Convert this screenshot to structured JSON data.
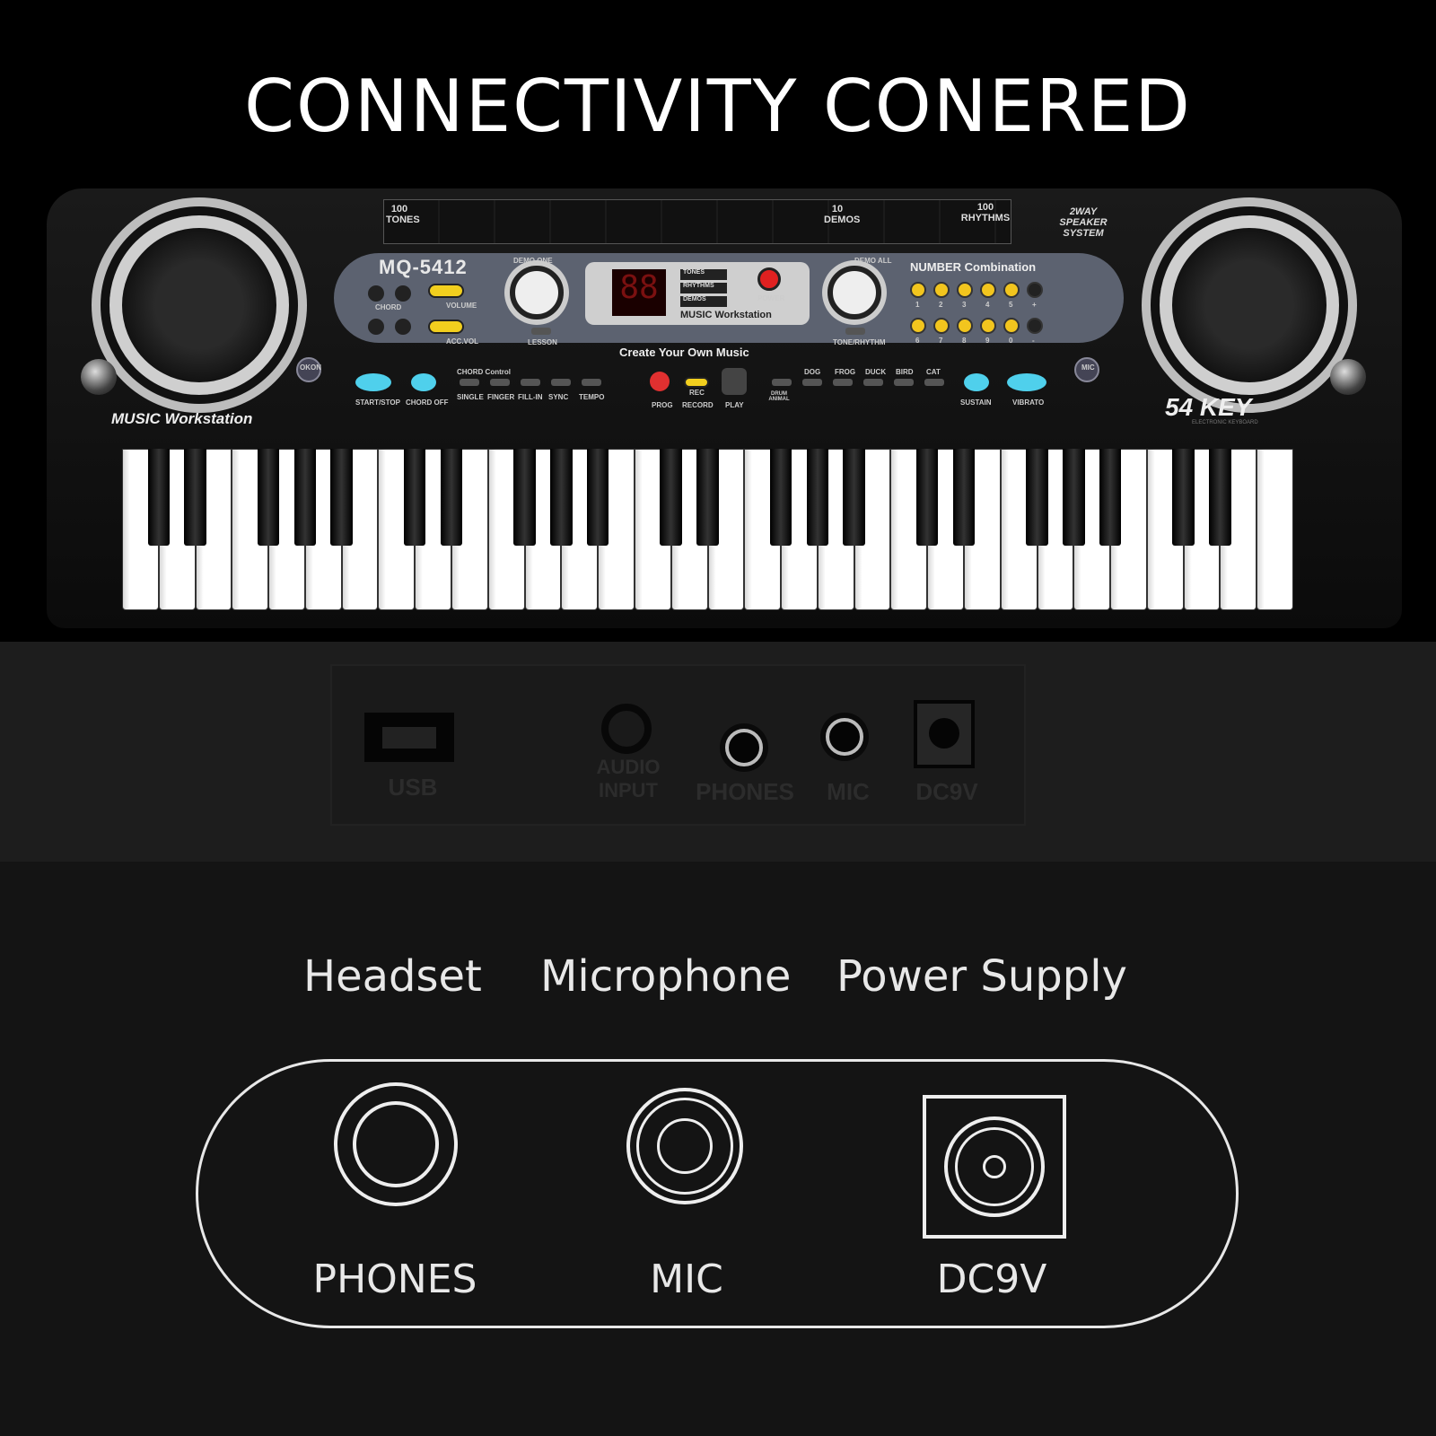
{
  "title": "CONNECTIVITY CONERED",
  "keyboard": {
    "model": "MQ-5412",
    "tones_badge": "100 TONES",
    "demos_badge": "10 DEMOS",
    "rhythms_badge": "100 RHYTHMS",
    "speaker_system": "2WAY SPEAKER SYSTEM",
    "display": "88",
    "mode_labels": [
      "TONES",
      "RHYTHMS",
      "DEMOS"
    ],
    "power_label": "POWER",
    "lcd_brand": "MUSIC Workstation",
    "demo_one": "DEMO ONE",
    "demo_all": "DEMO ALL",
    "number_combination": "NUMBER Combination",
    "numbers": [
      "1",
      "2",
      "3",
      "4",
      "5",
      "+",
      "6",
      "7",
      "8",
      "9",
      "0",
      "-"
    ],
    "chord_label": "CHORD",
    "volume_label": "VOLUME",
    "acc_vol_label": "ACC.VOL",
    "lesson_label": "LESSON",
    "tone_rhythm_label": "TONE/RHYTHM",
    "slogan": "Create Your Own Music",
    "okon_label": "OKON",
    "mic_label": "MIC",
    "start_stop": "START/STOP",
    "chord_off": "CHORD OFF",
    "chord_control": "CHORD Control",
    "chord_modes": [
      "SINGLE",
      "FINGER",
      "FILL-IN",
      "SYNC",
      "TEMPO"
    ],
    "prog": "PROG",
    "rec": "REC",
    "record": "RECORD",
    "play": "PLAY",
    "animal_sounds": [
      "DOG",
      "FROG",
      "DUCK",
      "BIRD",
      "CAT"
    ],
    "drum_animal": "DRUM ANIMAL",
    "sustain": "SUSTAIN",
    "vibrato": "VIBRATO",
    "brand": "MUSIC Workstation",
    "key_count": "54 KEY",
    "key_sub": "ELECTRONIC KEYBOARD",
    "white_keys": 32
  },
  "jack_panel": {
    "labels": [
      "USB",
      "AUDIO INPUT",
      "PHONES",
      "MIC",
      "DC9V"
    ]
  },
  "diagram": {
    "headings": [
      "Headset",
      "Microphone",
      "Power Supply"
    ],
    "ports": [
      "PHONES",
      "MIC",
      "DC9V"
    ]
  }
}
